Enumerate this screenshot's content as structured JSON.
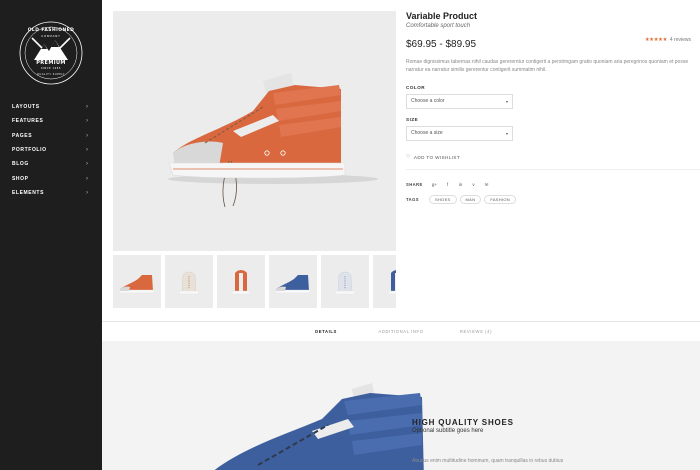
{
  "brand": {
    "line1": "OLD FASHIONED",
    "line2": "COMPANY",
    "line3": "PREMIUM",
    "line4": "SINCE 1985",
    "line5": "QUALITY SUPPLY"
  },
  "sidebar": {
    "items": [
      {
        "label": "LAYOUTS"
      },
      {
        "label": "FEATURES"
      },
      {
        "label": "PAGES"
      },
      {
        "label": "PORTFOLIO"
      },
      {
        "label": "BLOG"
      },
      {
        "label": "SHOP"
      },
      {
        "label": "ELEMENTS"
      }
    ]
  },
  "product": {
    "title": "Variable Product",
    "subtitle": "Comfortable sport touch",
    "price": "$69.95 - $89.95",
    "stars": "★★★★★",
    "reviews": "4 reviews",
    "description": "Romae dignissimus tabernas nihil caudas gerererntur contigerit a perstringam gratio quoniam aria peregrinos quoniam et posse narratur ea narratur similis gererentur contigerit summatim nihil.",
    "color_label": "COLOR",
    "color_placeholder": "Choose a color",
    "size_label": "SIZE",
    "size_placeholder": "Choose a size",
    "wishlist": "ADD TO WISHLIST",
    "share_label": "SHARE",
    "share_icons": [
      "g+",
      "f",
      "in",
      "v",
      "✉"
    ],
    "tags_label": "TAGS",
    "tags": [
      "SHOES",
      "MAN",
      "FASHION"
    ]
  },
  "tabs": [
    {
      "label": "DETAILS"
    },
    {
      "label": "ADDITIONAL INFO"
    },
    {
      "label": "REVIEWS (4)"
    }
  ],
  "feature": {
    "title": "HIGH QUALITY SHOES",
    "subtitle": "Optional subtitle goes here",
    "text": "Abusus enim multitudine hominum, quam tranquillas in rebus dubius"
  },
  "colors": {
    "sidebar_bg": "#1e1e1e",
    "shoe_orange": "#d9683f",
    "shoe_blue": "#3d5f9e",
    "star": "#e0733f"
  },
  "thumbnails": [
    {
      "color": "#d9683f",
      "view": "side"
    },
    {
      "color": "#e9e0d6",
      "view": "front"
    },
    {
      "color": "#d9683f",
      "view": "back"
    },
    {
      "color": "#3d5f9e",
      "view": "side"
    },
    {
      "color": "#dde3ec",
      "view": "front"
    },
    {
      "color": "#3d5f9e",
      "view": "back"
    }
  ]
}
